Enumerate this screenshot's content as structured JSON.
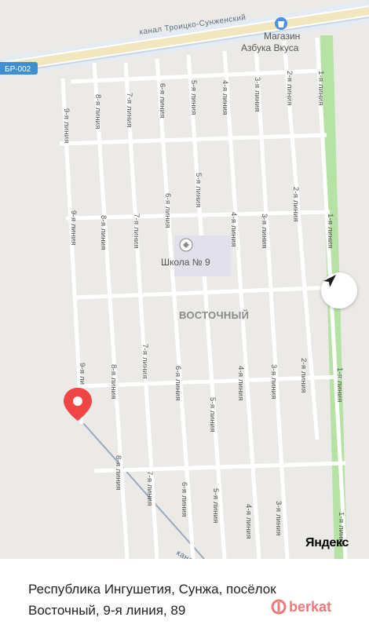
{
  "map": {
    "canal_label": "канал Троицко-Сунженский",
    "canal_label_bottom": "канал",
    "highway_label": "БР-002",
    "poi_shop": {
      "name": "Магазин",
      "subtitle": "Азбука Вкуса",
      "icon": "shop-bag-icon"
    },
    "poi_school": {
      "name": "Школа № 9",
      "icon": "school-icon"
    },
    "district": "ВОСТОЧНЫЙ",
    "street_labels": [
      "1-я линия",
      "2-я линия",
      "3-я линия",
      "4-я линия",
      "5-я линия",
      "6-я линия",
      "7-я линия",
      "8-я линия",
      "9-я линия",
      "9-я ли"
    ],
    "pin_icon": "location-pin-icon",
    "compass_icon": "navigation-arrow-icon",
    "provider": "Яндекс",
    "colors": {
      "pin": "#f04545",
      "park": "#b6e3a5",
      "road": "#ffffff",
      "canal_road": "#f3e9c4"
    }
  },
  "address": {
    "line1": "Республика Ингушетия, Сунжа, посёлок",
    "line2": "Восточный, 9-я линия, 89"
  },
  "watermark": {
    "text": "berkat",
    "icon": "berkat-logo-icon"
  }
}
